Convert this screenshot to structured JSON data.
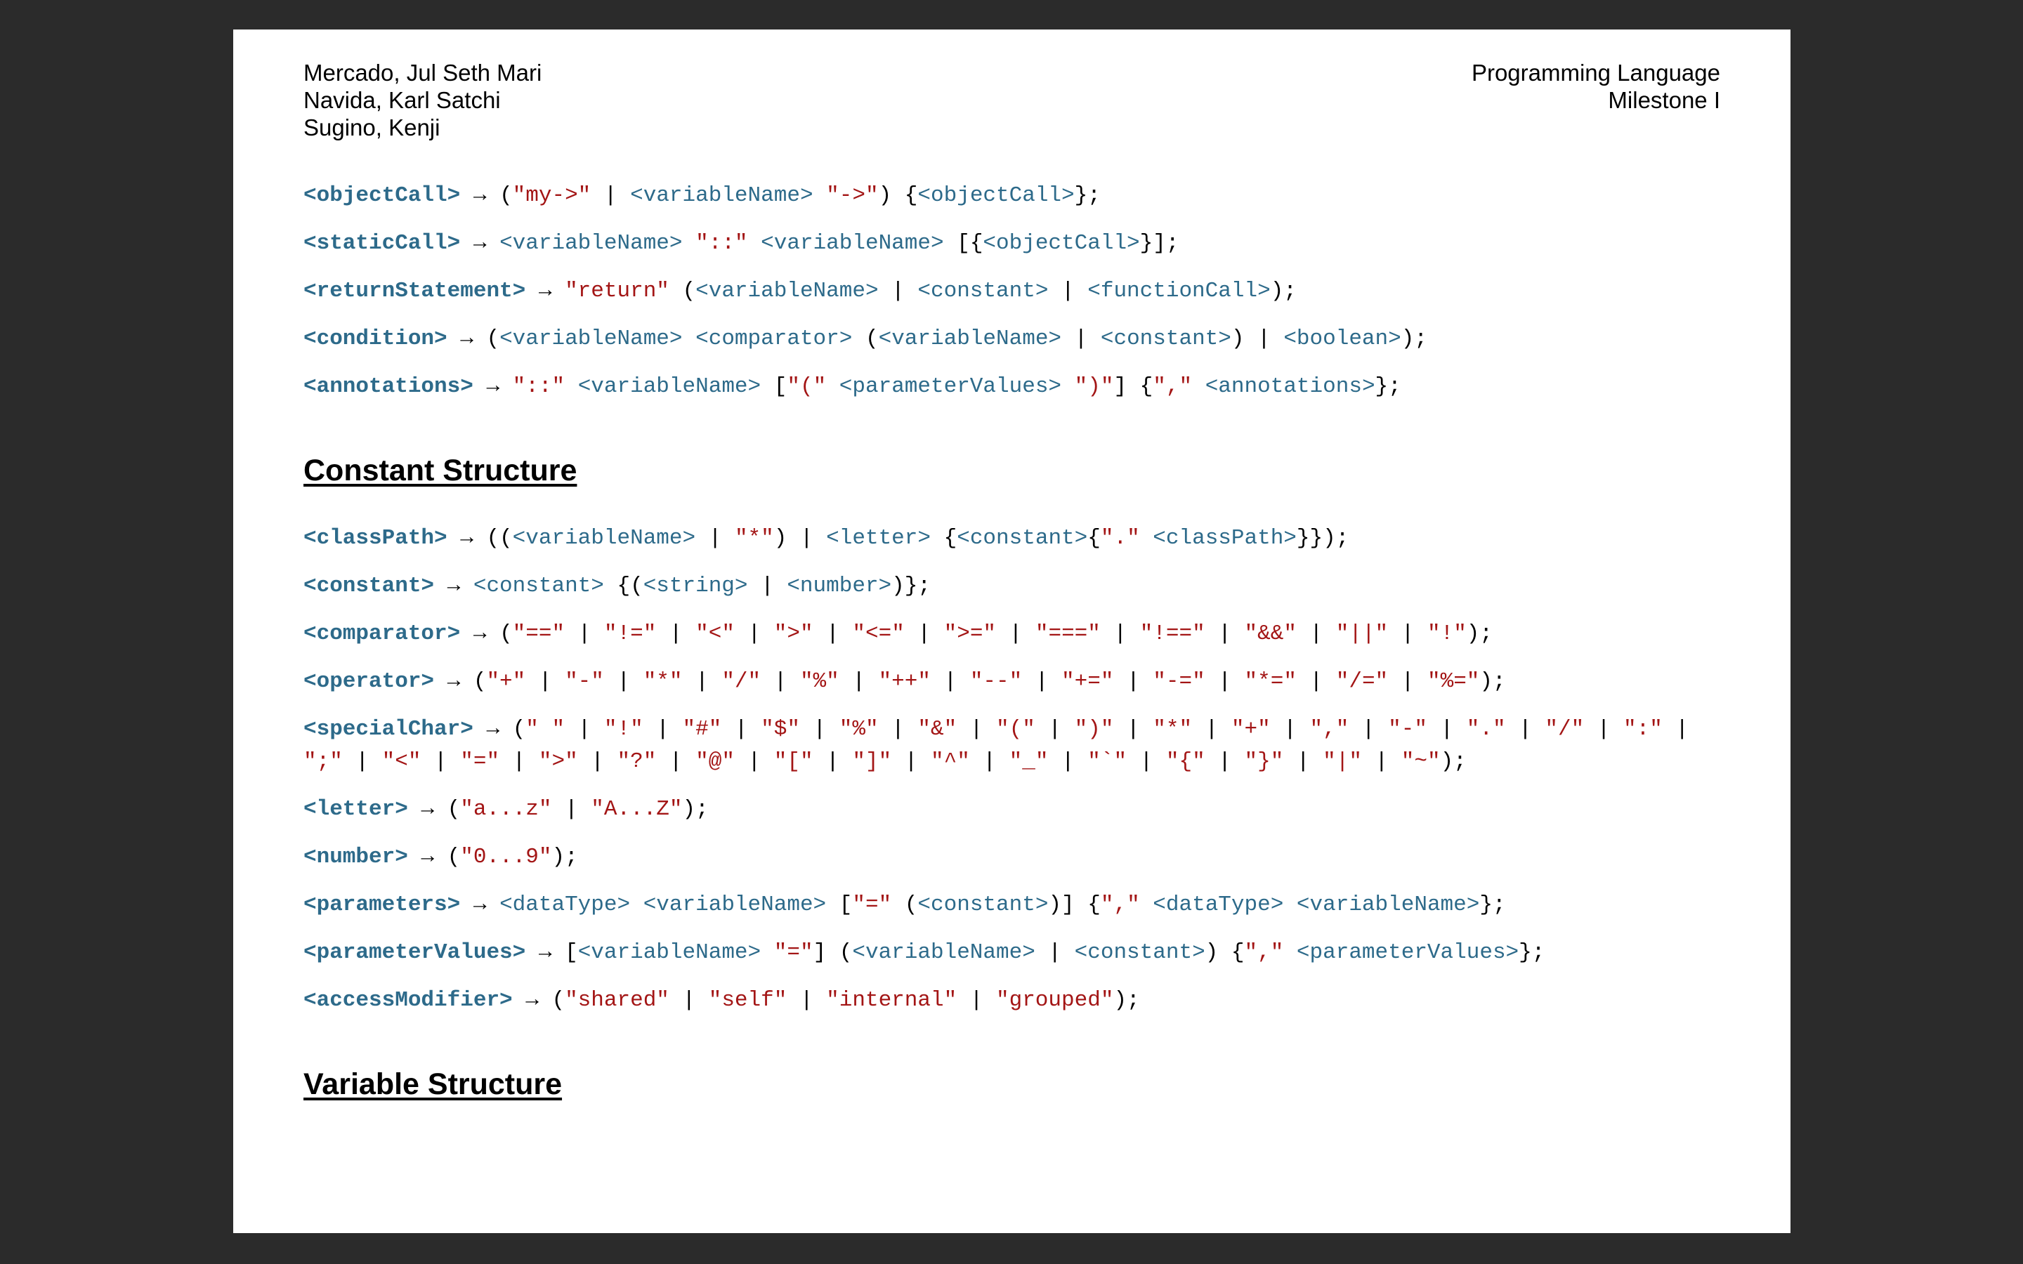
{
  "header": {
    "authors": [
      "Mercado, Jul Seth Mari",
      "Navida, Karl Satchi",
      "Sugino, Kenji"
    ],
    "course": [
      "Programming Language",
      "Milestone I"
    ]
  },
  "sections": [
    {
      "title": "",
      "rules": [
        {
          "lhs": "<objectCall>",
          "tokens": [
            [
              "p",
              "("
            ],
            [
              "s",
              "\"my->\""
            ],
            [
              "p",
              " | "
            ],
            [
              "n",
              "<variableName>"
            ],
            [
              "p",
              " "
            ],
            [
              "s",
              "\"->\""
            ],
            [
              "p",
              ") {"
            ],
            [
              "n",
              "<objectCall>"
            ],
            [
              "p",
              "};"
            ]
          ]
        },
        {
          "lhs": "<staticCall>",
          "tokens": [
            [
              "n",
              "<variableName>"
            ],
            [
              "p",
              " "
            ],
            [
              "s",
              "\"::\""
            ],
            [
              "p",
              " "
            ],
            [
              "n",
              "<variableName>"
            ],
            [
              "p",
              " [{"
            ],
            [
              "n",
              "<objectCall>"
            ],
            [
              "p",
              "}];"
            ]
          ]
        },
        {
          "lhs": "<returnStatement>",
          "tokens": [
            [
              "s",
              "\"return\""
            ],
            [
              "p",
              " ("
            ],
            [
              "n",
              "<variableName>"
            ],
            [
              "p",
              " | "
            ],
            [
              "n",
              "<constant>"
            ],
            [
              "p",
              " | "
            ],
            [
              "n",
              "<functionCall>"
            ],
            [
              "p",
              ");"
            ]
          ]
        },
        {
          "lhs": "<condition>",
          "tokens": [
            [
              "p",
              "("
            ],
            [
              "n",
              "<variableName>"
            ],
            [
              "p",
              " "
            ],
            [
              "n",
              "<comparator>"
            ],
            [
              "p",
              " ("
            ],
            [
              "n",
              "<variableName>"
            ],
            [
              "p",
              " | "
            ],
            [
              "n",
              "<constant>"
            ],
            [
              "p",
              ") | "
            ],
            [
              "n",
              "<boolean>"
            ],
            [
              "p",
              ");"
            ]
          ]
        },
        {
          "lhs": "<annotations>",
          "tokens": [
            [
              "s",
              "\"::\""
            ],
            [
              "p",
              " "
            ],
            [
              "n",
              "<variableName>"
            ],
            [
              "p",
              " ["
            ],
            [
              "s",
              "\"(\""
            ],
            [
              "p",
              " "
            ],
            [
              "n",
              "<parameterValues>"
            ],
            [
              "p",
              " "
            ],
            [
              "s",
              "\")\""
            ],
            [
              "p",
              "] {"
            ],
            [
              "s",
              "\",\""
            ],
            [
              "p",
              " "
            ],
            [
              "n",
              "<annotations>"
            ],
            [
              "p",
              "};"
            ]
          ]
        }
      ]
    },
    {
      "title": "Constant Structure",
      "rules": [
        {
          "lhs": "<classPath>",
          "tokens": [
            [
              "p",
              "(("
            ],
            [
              "n",
              "<variableName>"
            ],
            [
              "p",
              " | "
            ],
            [
              "s",
              "\"*\""
            ],
            [
              "p",
              ") | "
            ],
            [
              "n",
              "<letter>"
            ],
            [
              "p",
              " {"
            ],
            [
              "n",
              "<constant>"
            ],
            [
              "p",
              "{"
            ],
            [
              "s",
              "\".\""
            ],
            [
              "p",
              " "
            ],
            [
              "n",
              "<classPath>"
            ],
            [
              "p",
              "}});"
            ]
          ]
        },
        {
          "lhs": "<constant>",
          "tokens": [
            [
              "n",
              "<constant>"
            ],
            [
              "p",
              " {("
            ],
            [
              "n",
              "<string>"
            ],
            [
              "p",
              " | "
            ],
            [
              "n",
              "<number>"
            ],
            [
              "p",
              ")};"
            ]
          ]
        },
        {
          "lhs": "<comparator>",
          "tokens": [
            [
              "p",
              "("
            ],
            [
              "s",
              "\"==\""
            ],
            [
              "p",
              " | "
            ],
            [
              "s",
              "\"!=\""
            ],
            [
              "p",
              " | "
            ],
            [
              "s",
              "\"<\""
            ],
            [
              "p",
              " | "
            ],
            [
              "s",
              "\">\""
            ],
            [
              "p",
              " | "
            ],
            [
              "s",
              "\"<=\""
            ],
            [
              "p",
              " | "
            ],
            [
              "s",
              "\">=\""
            ],
            [
              "p",
              " | "
            ],
            [
              "s",
              "\"===\""
            ],
            [
              "p",
              " | "
            ],
            [
              "s",
              "\"!==\""
            ],
            [
              "p",
              " | "
            ],
            [
              "s",
              "\"&&\""
            ],
            [
              "p",
              " | "
            ],
            [
              "s",
              "\"||\""
            ],
            [
              "p",
              " | "
            ],
            [
              "s",
              "\"!\""
            ],
            [
              "p",
              ");"
            ]
          ]
        },
        {
          "lhs": "<operator>",
          "tokens": [
            [
              "p",
              "("
            ],
            [
              "s",
              "\"+\""
            ],
            [
              "p",
              " | "
            ],
            [
              "s",
              "\"-\""
            ],
            [
              "p",
              " | "
            ],
            [
              "s",
              "\"*\""
            ],
            [
              "p",
              " | "
            ],
            [
              "s",
              "\"/\""
            ],
            [
              "p",
              " | "
            ],
            [
              "s",
              "\"%\""
            ],
            [
              "p",
              " | "
            ],
            [
              "s",
              "\"++\""
            ],
            [
              "p",
              " | "
            ],
            [
              "s",
              "\"--\""
            ],
            [
              "p",
              " | "
            ],
            [
              "s",
              "\"+=\""
            ],
            [
              "p",
              " | "
            ],
            [
              "s",
              "\"-=\""
            ],
            [
              "p",
              " | "
            ],
            [
              "s",
              "\"*=\""
            ],
            [
              "p",
              " | "
            ],
            [
              "s",
              "\"/=\""
            ],
            [
              "p",
              " | "
            ],
            [
              "s",
              "\"%=\""
            ],
            [
              "p",
              ");"
            ]
          ]
        },
        {
          "lhs": "<specialChar>",
          "tokens": [
            [
              "p",
              "("
            ],
            [
              "s",
              "\" \""
            ],
            [
              "p",
              " | "
            ],
            [
              "s",
              "\"!\""
            ],
            [
              "p",
              " | "
            ],
            [
              "s",
              "\"#\""
            ],
            [
              "p",
              " | "
            ],
            [
              "s",
              "\"$\""
            ],
            [
              "p",
              " | "
            ],
            [
              "s",
              "\"%\""
            ],
            [
              "p",
              " | "
            ],
            [
              "s",
              "\"&\""
            ],
            [
              "p",
              " | "
            ],
            [
              "s",
              "\"(\""
            ],
            [
              "p",
              " | "
            ],
            [
              "s",
              "\")\""
            ],
            [
              "p",
              " | "
            ],
            [
              "s",
              "\"*\""
            ],
            [
              "p",
              " | "
            ],
            [
              "s",
              "\"+\""
            ],
            [
              "p",
              " | "
            ],
            [
              "s",
              "\",\""
            ],
            [
              "p",
              " | "
            ],
            [
              "s",
              "\"-\""
            ],
            [
              "p",
              " | "
            ],
            [
              "s",
              "\".\""
            ],
            [
              "p",
              " | "
            ],
            [
              "s",
              "\"/\""
            ],
            [
              "p",
              " | "
            ],
            [
              "s",
              "\":\""
            ],
            [
              "p",
              " |\n"
            ],
            [
              "s",
              "\";\""
            ],
            [
              "p",
              " | "
            ],
            [
              "s",
              "\"<\""
            ],
            [
              "p",
              " | "
            ],
            [
              "s",
              "\"=\""
            ],
            [
              "p",
              " | "
            ],
            [
              "s",
              "\">\""
            ],
            [
              "p",
              " | "
            ],
            [
              "s",
              "\"?\""
            ],
            [
              "p",
              " | "
            ],
            [
              "s",
              "\"@\""
            ],
            [
              "p",
              " | "
            ],
            [
              "s",
              "\"[\""
            ],
            [
              "p",
              " | "
            ],
            [
              "s",
              "\"]\""
            ],
            [
              "p",
              " | "
            ],
            [
              "s",
              "\"^\""
            ],
            [
              "p",
              " | "
            ],
            [
              "s",
              "\"_\""
            ],
            [
              "p",
              " | "
            ],
            [
              "s",
              "\"`\""
            ],
            [
              "p",
              " | "
            ],
            [
              "s",
              "\"{\""
            ],
            [
              "p",
              " | "
            ],
            [
              "s",
              "\"}\""
            ],
            [
              "p",
              " | "
            ],
            [
              "s",
              "\"|\""
            ],
            [
              "p",
              " | "
            ],
            [
              "s",
              "\"~\""
            ],
            [
              "p",
              ");"
            ]
          ]
        },
        {
          "lhs": "<letter>",
          "tokens": [
            [
              "p",
              "("
            ],
            [
              "s",
              "\"a...z\""
            ],
            [
              "p",
              " | "
            ],
            [
              "s",
              "\"A...Z\""
            ],
            [
              "p",
              ");"
            ]
          ]
        },
        {
          "lhs": "<number>",
          "tokens": [
            [
              "p",
              "("
            ],
            [
              "s",
              "\"0...9\""
            ],
            [
              "p",
              ");"
            ]
          ]
        },
        {
          "lhs": "<parameters>",
          "tokens": [
            [
              "n",
              "<dataType>"
            ],
            [
              "p",
              " "
            ],
            [
              "n",
              "<variableName>"
            ],
            [
              "p",
              " ["
            ],
            [
              "s",
              "\"=\""
            ],
            [
              "p",
              " ("
            ],
            [
              "n",
              "<constant>"
            ],
            [
              "p",
              ")] {"
            ],
            [
              "s",
              "\",\""
            ],
            [
              "p",
              " "
            ],
            [
              "n",
              "<dataType>"
            ],
            [
              "p",
              " "
            ],
            [
              "n",
              "<variableName>"
            ],
            [
              "p",
              "};"
            ]
          ]
        },
        {
          "lhs": "<parameterValues>",
          "tokens": [
            [
              "p",
              "["
            ],
            [
              "n",
              "<variableName>"
            ],
            [
              "p",
              " "
            ],
            [
              "s",
              "\"=\""
            ],
            [
              "p",
              "] ("
            ],
            [
              "n",
              "<variableName>"
            ],
            [
              "p",
              " | "
            ],
            [
              "n",
              "<constant>"
            ],
            [
              "p",
              ") {"
            ],
            [
              "s",
              "\",\""
            ],
            [
              "p",
              " "
            ],
            [
              "n",
              "<parameterValues>"
            ],
            [
              "p",
              "};"
            ]
          ]
        },
        {
          "lhs": "<accessModifier>",
          "tokens": [
            [
              "p",
              "("
            ],
            [
              "s",
              "\"shared\""
            ],
            [
              "p",
              " | "
            ],
            [
              "s",
              "\"self\""
            ],
            [
              "p",
              " | "
            ],
            [
              "s",
              "\"internal\""
            ],
            [
              "p",
              " | "
            ],
            [
              "s",
              "\"grouped\""
            ],
            [
              "p",
              ");"
            ]
          ]
        }
      ]
    },
    {
      "title": "Variable Structure",
      "rules": []
    }
  ],
  "arrow": "→",
  "colors": {
    "background": "#2b2b2b",
    "page": "#ffffff",
    "nonterminal": "#2d6a8a",
    "string": "#a31515",
    "text": "#000000"
  }
}
